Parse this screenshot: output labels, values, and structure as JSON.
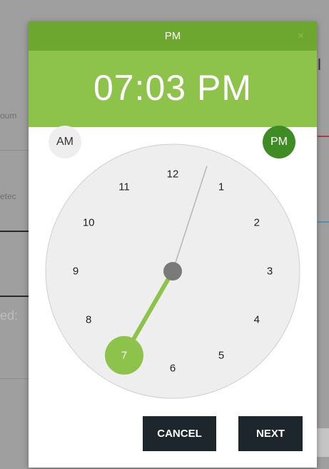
{
  "background": {
    "left_fragments": [
      "oum",
      "etec",
      "ed:"
    ],
    "right_fragment": "l"
  },
  "modal": {
    "header_title": "PM",
    "close_glyph": "×",
    "time_display": "07:03 PM",
    "am_label": "AM",
    "pm_label": "PM",
    "selected_period": "PM",
    "clock": {
      "numbers": [
        "12",
        "1",
        "2",
        "3",
        "4",
        "5",
        "6",
        "7",
        "8",
        "9",
        "10",
        "11"
      ],
      "selected_hour": "7",
      "selected_minute": 3
    },
    "cancel_label": "CANCEL",
    "next_label": "NEXT"
  },
  "colors": {
    "header": "#6ea72f",
    "time_bar": "#8dc24b",
    "accent": "#8dc24b",
    "pm_active": "#3f8b24",
    "clock_face": "#eeeeee",
    "button": "#1e262d"
  }
}
